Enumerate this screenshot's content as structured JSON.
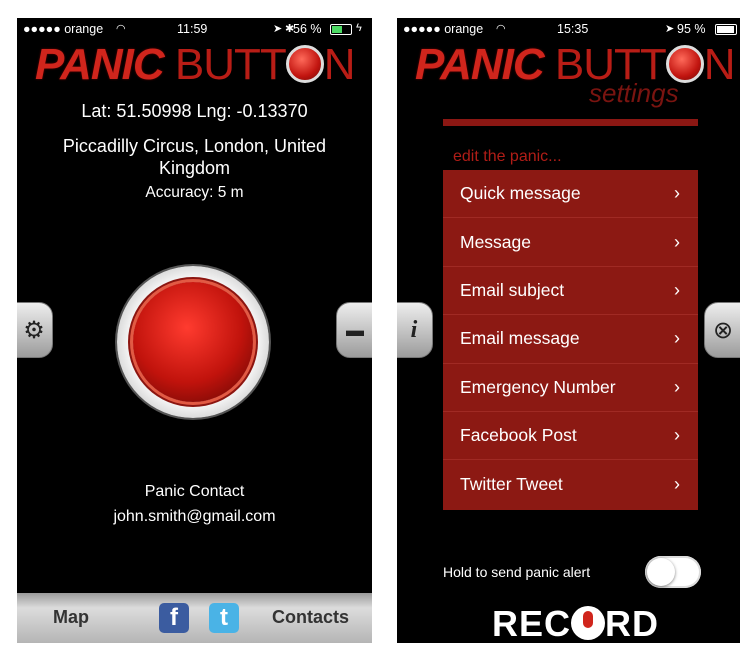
{
  "left_screen": {
    "status": {
      "carrier": "●●●●● orange",
      "wifi": "wifi-icon",
      "time": "11:59",
      "battery_pct": "56 %",
      "battery_level": 0.56
    },
    "logo": {
      "panic": "PANIC",
      "button_b": "BUTT",
      "button_n": "N"
    },
    "location": {
      "coords": "Lat: 51.50998 Lng: -0.13370",
      "address_line1": "Piccadilly Circus, London, United",
      "address_line2": "Kingdom",
      "accuracy": "Accuracy: 5 m"
    },
    "panic_contact": {
      "label": "Panic Contact",
      "email": "john.smith@gmail.com"
    },
    "left_tab_icon": "gear-icon",
    "right_tab_icon": "message-icon",
    "bottom_bar": {
      "map": "Map",
      "facebook": "f",
      "twitter": "t",
      "contacts": "Contacts"
    }
  },
  "right_screen": {
    "status": {
      "carrier": "●●●●● orange",
      "wifi": "wifi-icon",
      "time": "15:35",
      "battery_pct": "95 %",
      "battery_level": 0.95
    },
    "logo": {
      "panic": "PANIC",
      "button_b": "BUTT",
      "button_n": "N"
    },
    "settings_title": "settings",
    "edit_label": "edit the panic...",
    "menu_items": [
      "Quick message",
      "Message",
      "Email subject",
      "Email message",
      "Emergency Number",
      "Facebook Post",
      "Twitter Tweet"
    ],
    "chevron": "›",
    "left_tab_icon": "info-icon",
    "right_tab_icon": "close-icon",
    "hold_label": "Hold to send panic alert",
    "toggle_on": false,
    "record_pre": "REC",
    "record_post": "RD"
  }
}
